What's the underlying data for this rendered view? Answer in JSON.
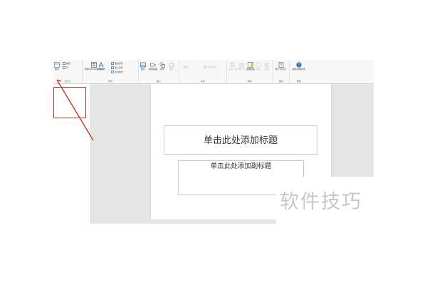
{
  "ribbon": {
    "groups": [
      {
        "label": "幻灯片",
        "items": [
          {
            "label": "版式",
            "icon": "layout-icon"
          },
          {
            "label": "重置",
            "icon": "reset-icon"
          },
          {
            "label": "节",
            "icon": "section-icon"
          }
        ]
      },
      {
        "label": "形状",
        "items": [
          {
            "label": "转换为SmartArt图形",
            "icon": "smartart-icon"
          },
          {
            "label": "添加文字",
            "icon": "text-icon"
          },
          {
            "label": "更改形状",
            "icon": "shape-icon"
          },
          {
            "label": "插入形状",
            "icon": "insert-shape-icon"
          },
          {
            "label": "形状格式",
            "icon": "format-shape-icon"
          }
        ]
      },
      {
        "label": "插入",
        "items": [
          {
            "label": "图片",
            "icon": "picture-icon"
          },
          {
            "label": "屏幕截图",
            "icon": "screenshot-icon"
          },
          {
            "label": "形状",
            "icon": "shapes-icon"
          },
          {
            "label": "图标",
            "icon": "icon-icon"
          }
        ]
      },
      {
        "label": "文本",
        "items": [
          {
            "label": "A",
            "icon": "font-icon"
          },
          {
            "label": "文字方向",
            "icon": "text-direction-icon"
          }
        ]
      },
      {
        "label": "排列",
        "items": [
          {
            "label": "上移一层",
            "icon": "bring-forward-icon"
          },
          {
            "label": "下移一层",
            "icon": "send-backward-icon"
          },
          {
            "label": "选择窗格",
            "icon": "selection-pane-icon"
          },
          {
            "label": "组合",
            "icon": "group-icon"
          },
          {
            "label": "对齐",
            "icon": "align-icon"
          }
        ]
      },
      {
        "label": "团队",
        "items": [
          {
            "label": "整个幻灯片",
            "icon": "team-icon"
          }
        ]
      },
      {
        "label": "帮助",
        "items": [
          {
            "label": "操作说明搜索",
            "icon": "help-icon"
          }
        ]
      }
    ]
  },
  "slide": {
    "title_placeholder": "单击此处添加标题",
    "subtitle_placeholder": "单击此处添加副标题"
  },
  "watermark": "软件技巧",
  "colors": {
    "accent_red": "#c0392b",
    "ribbon_bg": "#f7f7f7",
    "canvas_bg": "#e5e5e5",
    "help_blue": "#2b6cb0"
  }
}
